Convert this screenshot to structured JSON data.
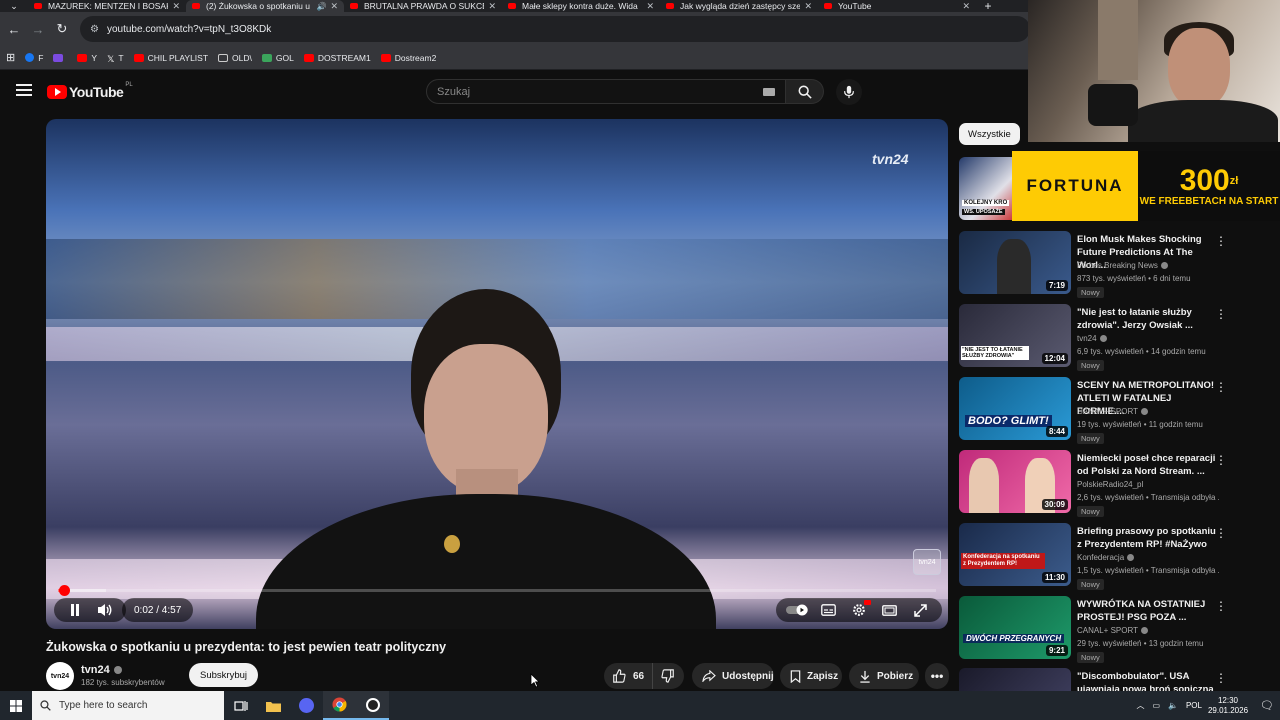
{
  "browser": {
    "tabs": [
      {
        "title": "MAZUREK: MENTZEN I BOSAK",
        "active": false
      },
      {
        "title": "(2) Żukowska o spotkaniu u",
        "active": true
      },
      {
        "title": "BRUTALNA PRAWDA O SUKCES",
        "active": false
      },
      {
        "title": "Małe sklepy kontra duże. Wida",
        "active": false
      },
      {
        "title": "Jak wygląda dzień zastępcy sze",
        "active": false
      },
      {
        "title": "YouTube",
        "active": false
      }
    ],
    "url": "youtube.com/watch?v=tpN_t3O8KDk",
    "bookmarks": [
      {
        "label": "F",
        "color": "#1877f2"
      },
      {
        "label": "",
        "color": "#7b4be0"
      },
      {
        "label": "Y",
        "color": "#ff0000"
      },
      {
        "label": "T",
        "color": "#111111"
      },
      {
        "label": "CHIL PLAYLIST",
        "color": "#ff0000"
      },
      {
        "label": "OLD\\",
        "color": "#cccccc"
      },
      {
        "label": "GOL",
        "color": "#3ba55c"
      },
      {
        "label": "DOSTREAM1",
        "color": "#ff0000"
      },
      {
        "label": "Dostream2",
        "color": "#ff0000"
      }
    ]
  },
  "youtube": {
    "logo_text": "YouTube",
    "country_code": "PL",
    "search_placeholder": "Szukaj",
    "player": {
      "channel_watermark": "tvn24",
      "current_time": "0:02",
      "duration": "4:57",
      "time_display": "0:02 / 4:57",
      "progress_fraction": 0.007,
      "buffered_fraction": 0.055,
      "bug_label": "tvn24"
    },
    "video_title": "Żukowska o spotkaniu u prezydenta: to jest pewien teatr polityczny",
    "channel": {
      "name": "tvn24",
      "avatar_text": "tvn24",
      "subscribers": "182 tys. subskrybentów"
    },
    "subscribe_label": "Subskrybuj",
    "actions": {
      "likes": "66",
      "share": "Udostępnij",
      "save": "Zapisz",
      "download": "Pobierz"
    },
    "filter_chip": "Wszystkie",
    "ad": {
      "brand": "FORTUNA",
      "amount": "300",
      "currency": "zł",
      "tagline": "WE FREEBETACH NA START"
    },
    "first_thumb_text": [
      "KOLEJNY KRO",
      "WS. UPOSAŻE"
    ],
    "recommendations": [
      {
        "title": "Elon Musk Makes Shocking Future Predictions At The Worl...",
        "channel": "Forbes Breaking News",
        "verified": true,
        "meta": "873 tys. wyświetleń • 6 dni temu",
        "badge": "Nowy",
        "duration": "7:19",
        "thumb_colors": [
          "#1a2a44",
          "#3a5a8c"
        ]
      },
      {
        "title": "\"Nie jest to łatanie służby zdrowia\". Jerzy Owsiak ...",
        "channel": "tvn24",
        "verified": true,
        "meta": "6,9 tys. wyświetleń • 14 godzin temu",
        "badge": "Nowy",
        "duration": "12:04",
        "thumb_colors": [
          "#2a2a3a",
          "#5a5a70"
        ]
      },
      {
        "title": "SCENY NA METROPOLITANO! ATLETI W FATALNEJ FORMIE....",
        "channel": "CANAL+ SPORT",
        "verified": true,
        "meta": "19 tys. wyświetleń • 11 godzin temu",
        "badge": "Nowy",
        "duration": "8:44",
        "thumb_colors": [
          "#0e5c8a",
          "#2a9ad6"
        ]
      },
      {
        "title": "Niemiecki poseł chce reparacji od Polski za Nord Stream. ...",
        "channel": "PolskieRadio24_pl",
        "verified": false,
        "meta": "2,6 tys. wyświetleń • Transmisja odbyła ...",
        "badge": "Nowy",
        "duration": "30:09",
        "thumb_colors": [
          "#c02a7a",
          "#f06aa8"
        ]
      },
      {
        "title": "Briefing prasowy po spotkaniu z Prezydentem RP! #NaŻywo",
        "channel": "Konfederacja",
        "verified": true,
        "meta": "1,5 tys. wyświetleń • Transmisja odbyła ...",
        "badge": "Nowy",
        "duration": "11:30",
        "thumb_colors": [
          "#1a2a4a",
          "#3c5c8c"
        ]
      },
      {
        "title": "WYWRÓTKA NA OSTATNIEJ PROSTEJ! PSG POZA ...",
        "channel": "CANAL+ SPORT",
        "verified": true,
        "meta": "29 tys. wyświetleń • 13 godzin temu",
        "badge": "Nowy",
        "duration": "9:21",
        "thumb_colors": [
          "#0a5a3a",
          "#1e9a6a"
        ]
      },
      {
        "title": "\"Discombobulator\". USA ujawniają nową broń soniczną ...",
        "channel": "",
        "verified": false,
        "meta": "",
        "badge": "",
        "duration": "",
        "thumb_colors": [
          "#1a1a2a",
          "#444466"
        ]
      }
    ],
    "thumb_overlays": {
      "rec2": "\"NIE JEST TO ŁATANIE SŁUŻBY ZDROWIA\"",
      "rec3": "BODO? GLIMT!",
      "rec5": "Konfederacja na spotkaniu z Prezydentem RP!",
      "rec6": "DWÓCH PRZEGRANYCH"
    }
  },
  "taskbar": {
    "search_placeholder": "Type here to search",
    "language": "POL",
    "time": "12:30",
    "date": "29.01.2026"
  },
  "colors": {
    "accent": "#ff0000",
    "ad_yellow": "#fecb04"
  }
}
